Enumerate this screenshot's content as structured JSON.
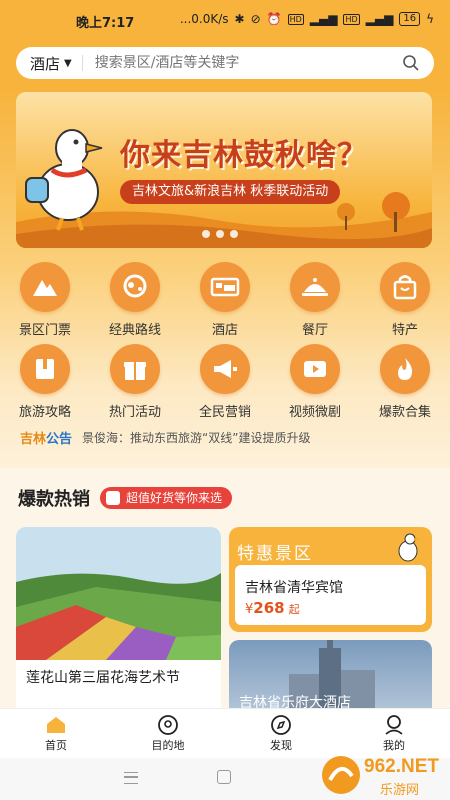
{
  "status_bar": {
    "time": "晚上7:17",
    "net": "...0.0K/s",
    "hd1": "HD",
    "hd2": "HD",
    "battery": "16"
  },
  "search": {
    "city": "酒店",
    "placeholder": "搜索景区/酒店等关键字"
  },
  "banner": {
    "headline": "你来吉林鼓秋啥？",
    "pill": "吉林文旅&新浪吉林 秋季联动活动",
    "dot_count": 3
  },
  "menu": [
    {
      "label": "景区门票",
      "icon": "mountain-icon"
    },
    {
      "label": "经典路线",
      "icon": "route-icon"
    },
    {
      "label": "酒店",
      "icon": "bed-icon"
    },
    {
      "label": "餐厅",
      "icon": "dish-icon"
    },
    {
      "label": "特产",
      "icon": "shopping-bag-icon"
    },
    {
      "label": "旅游攻略",
      "icon": "book-icon"
    },
    {
      "label": "热门活动",
      "icon": "gift-icon"
    },
    {
      "label": "全民营销",
      "icon": "megaphone-icon"
    },
    {
      "label": "视频微剧",
      "icon": "video-icon"
    },
    {
      "label": "爆款合集",
      "icon": "flame-icon"
    }
  ],
  "notice": {
    "brand1": "吉林",
    "brand2": "公告",
    "text": "景俊海：推动东西旅游“双线”建设提质升级"
  },
  "hot_section": {
    "title": "爆款热销",
    "tag": "超值好货等你来选"
  },
  "cards": {
    "left_caption": "莲花山第三届花海艺术节",
    "special_title": "特惠景区",
    "special_hotel": "吉林省清华宾馆",
    "special_price_symbol": "¥",
    "special_price": "268",
    "special_price_suffix": "起",
    "hotel_card_name": "吉林省乐府大酒店"
  },
  "tabs": [
    {
      "label": "首页",
      "icon": "home-icon"
    },
    {
      "label": "目的地",
      "icon": "location-icon"
    },
    {
      "label": "发现",
      "icon": "compass-icon"
    },
    {
      "label": "我的",
      "icon": "user-icon"
    }
  ],
  "watermark": {
    "brand": "962.NET",
    "sub": "乐游网"
  },
  "colors": {
    "primary": "#f7b33c",
    "icon_bg": "#f2963b",
    "accent_red": "#e8433b",
    "price": "#e2531c"
  }
}
